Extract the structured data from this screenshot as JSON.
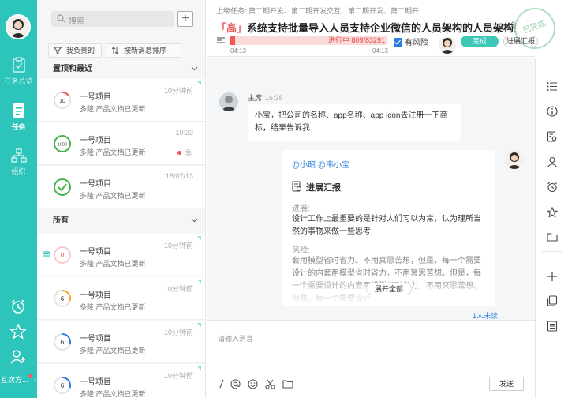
{
  "nav": {
    "items": [
      {
        "label": "任务总览",
        "icon": "clipboard-check-icon"
      },
      {
        "label": "任务",
        "icon": "task-list-icon"
      },
      {
        "label": "组织",
        "icon": "org-chart-icon"
      }
    ],
    "bottom_icons": [
      "alarm-clock-icon",
      "star-icon",
      "add-user-icon"
    ],
    "user_menu_label": "互次方..."
  },
  "list": {
    "search_placeholder": "搜索",
    "filters": {
      "mine": "我负责的",
      "sort": "按新消息排序"
    },
    "sections": {
      "pinned": "置顶和最近",
      "all": "所有"
    },
    "pinned_items": [
      {
        "title": "一号项目",
        "sub": "多隆:产品文档已更新",
        "time": "10分钟前",
        "ring_text": "10",
        "progress": 0.15,
        "ring_color": "#f25656"
      },
      {
        "title": "一号项目",
        "sub": "多隆:产品文档已更新",
        "time": "10:33",
        "ring_text": "1000",
        "progress": 1.0,
        "ring_color": "#43b449",
        "mute": "急"
      },
      {
        "title": "一号项目",
        "sub": "多隆:产品文档已更新",
        "time": "18/07/13",
        "ring_text": "",
        "progress": 1.0,
        "ring_color": "#43b449",
        "done": true
      }
    ],
    "all_items": [
      {
        "title": "一号项目",
        "sub": "多隆:产品文档已更新",
        "time": "10分钟前",
        "ring_text": "0",
        "progress": 0.0,
        "ring_color": "#f25656"
      },
      {
        "title": "一号项目",
        "sub": "多隆:产品文档已更新",
        "time": "10分钟前",
        "ring_text": "6",
        "progress": 0.3,
        "ring_color": "#f5a623"
      },
      {
        "title": "一号项目",
        "sub": "多隆:产品文档已更新",
        "time": "10分钟前",
        "ring_text": "6",
        "progress": 0.3,
        "ring_color": "#2a7de1"
      },
      {
        "title": "一号项目",
        "sub": "多隆:产品文档已更新",
        "time": "10分钟前",
        "ring_text": "6",
        "progress": 0.3,
        "ring_color": "#2a7de1"
      }
    ]
  },
  "task": {
    "parent": "上级任务:   第二期开发、第二期开发交互、第二期开发、第二期开",
    "priority": "「高」",
    "title": "系统支持批量导入人员支持企业微信的人员架构的人员架构架构架",
    "stamp": "已完成",
    "progress_text": "进行中 809/83291",
    "progress_fraction": 0.03,
    "start_time": "04:13",
    "end_time": "04:13",
    "risk_label": "有风险",
    "done_label": "完成",
    "report_label": "进展汇报"
  },
  "chat": {
    "msg1": {
      "name": "主席",
      "time": "16:38",
      "text": "小宝，把公司的名称、app名称、app icon去注册一下商标，结果告诉我"
    },
    "card": {
      "mentions": "@小昭 @韦小宝",
      "title": "进展汇报",
      "progress_label": "进展:",
      "progress_text": "设计工作上最重要的是针对人们习以为常，认为理所当然的事物来做一些思考",
      "risk_label": "风险:",
      "risk_text": "套用模型省时省力。不用冥思苦想，但是，每一个需要设计的内套用模型省时省力，不用冥思苦想。但是，每一个需要设计的内套用模型省时省力，不用冥思苦想。但是，每一个需要设计",
      "expand_label": "展开全部",
      "unread": "1人未读"
    }
  },
  "compose": {
    "placeholder": "请输入消息",
    "send_label": "发送",
    "tools": [
      "slash-command-icon",
      "at-mention-icon",
      "emoji-icon",
      "scissors-icon",
      "folder-icon"
    ]
  },
  "right_toolbar": [
    "list-icon",
    "info-icon",
    "document-search-icon",
    "user-icon",
    "alarm-clock-icon",
    "star-icon",
    "folder-icon",
    "plus-icon",
    "copy-icon",
    "archive-icon"
  ],
  "colors": {
    "accent": "#2cc4bb",
    "danger": "#f25656",
    "link": "#2a7de1",
    "success": "#43b449"
  }
}
